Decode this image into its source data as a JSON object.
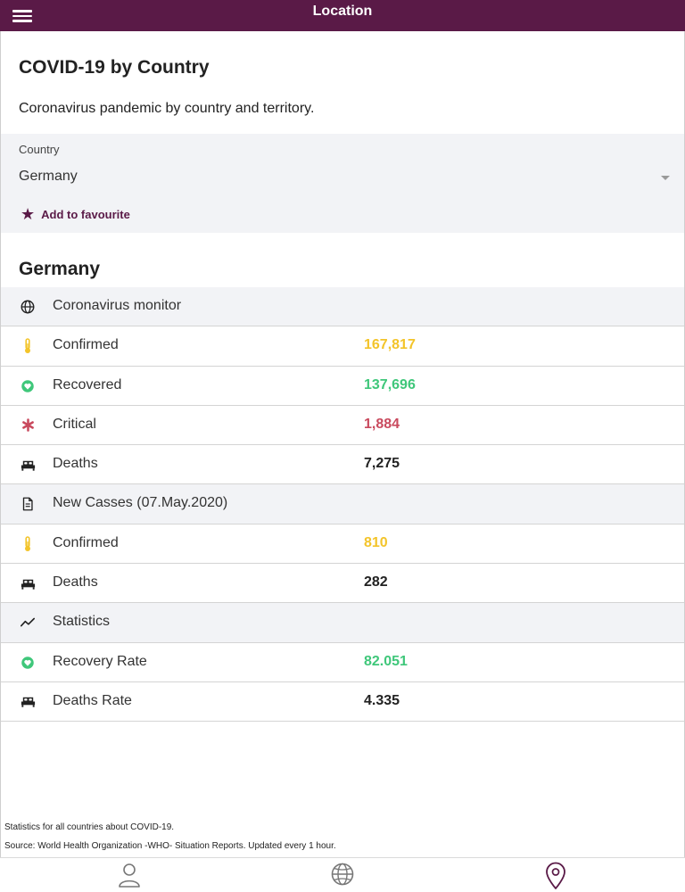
{
  "header": {
    "title": "Location",
    "menu_icon": "hamburger-menu-icon",
    "background_color": "#5a1a47"
  },
  "intro": {
    "title": "COVID-19 by Country",
    "subtitle": "Coronavirus pandemic by country and territory."
  },
  "country_selector": {
    "label": "Country",
    "selected": "Germany",
    "favourite_label": "Add to favourite",
    "favourite_icon": "star-icon"
  },
  "country_heading": "Germany",
  "sections": {
    "monitor": {
      "label": "Coronavirus monitor",
      "icon": "globe-icon",
      "rows": [
        {
          "label": "Confirmed",
          "value": "167,817",
          "icon": "thermometer-icon",
          "color": "#f3c42a"
        },
        {
          "label": "Recovered",
          "value": "137,696",
          "icon": "heart-badge-icon",
          "color": "#3fc77a"
        },
        {
          "label": "Critical",
          "value": "1,884",
          "icon": "asterisk-icon",
          "color": "#c94a5e"
        },
        {
          "label": "Deaths",
          "value": "7,275",
          "icon": "bed-icon",
          "color": "#222222"
        }
      ]
    },
    "new_cases": {
      "label": "New Casses (07.May.2020)",
      "icon": "document-icon",
      "rows": [
        {
          "label": "Confirmed",
          "value": "810",
          "icon": "thermometer-icon",
          "color": "#f3c42a"
        },
        {
          "label": "Deaths",
          "value": "282",
          "icon": "bed-icon",
          "color": "#222222"
        }
      ]
    },
    "statistics": {
      "label": "Statistics",
      "icon": "trend-line-icon",
      "rows": [
        {
          "label": "Recovery Rate",
          "value": "82.051",
          "icon": "heart-badge-icon",
          "color": "#3fc77a"
        },
        {
          "label": "Deaths Rate",
          "value": "4.335",
          "icon": "bed-icon",
          "color": "#222222"
        }
      ]
    }
  },
  "footer": {
    "line1": "Statistics for all countries about COVID-19.",
    "line2": "Source: World Health Organization -WHO- Situation Reports. Updated every 1 hour."
  },
  "bottom_nav": {
    "items": [
      {
        "name": "profile",
        "icon": "person-icon",
        "active": false
      },
      {
        "name": "global",
        "icon": "globe-icon",
        "active": false
      },
      {
        "name": "location",
        "icon": "location-pin-icon",
        "active": true
      }
    ]
  }
}
